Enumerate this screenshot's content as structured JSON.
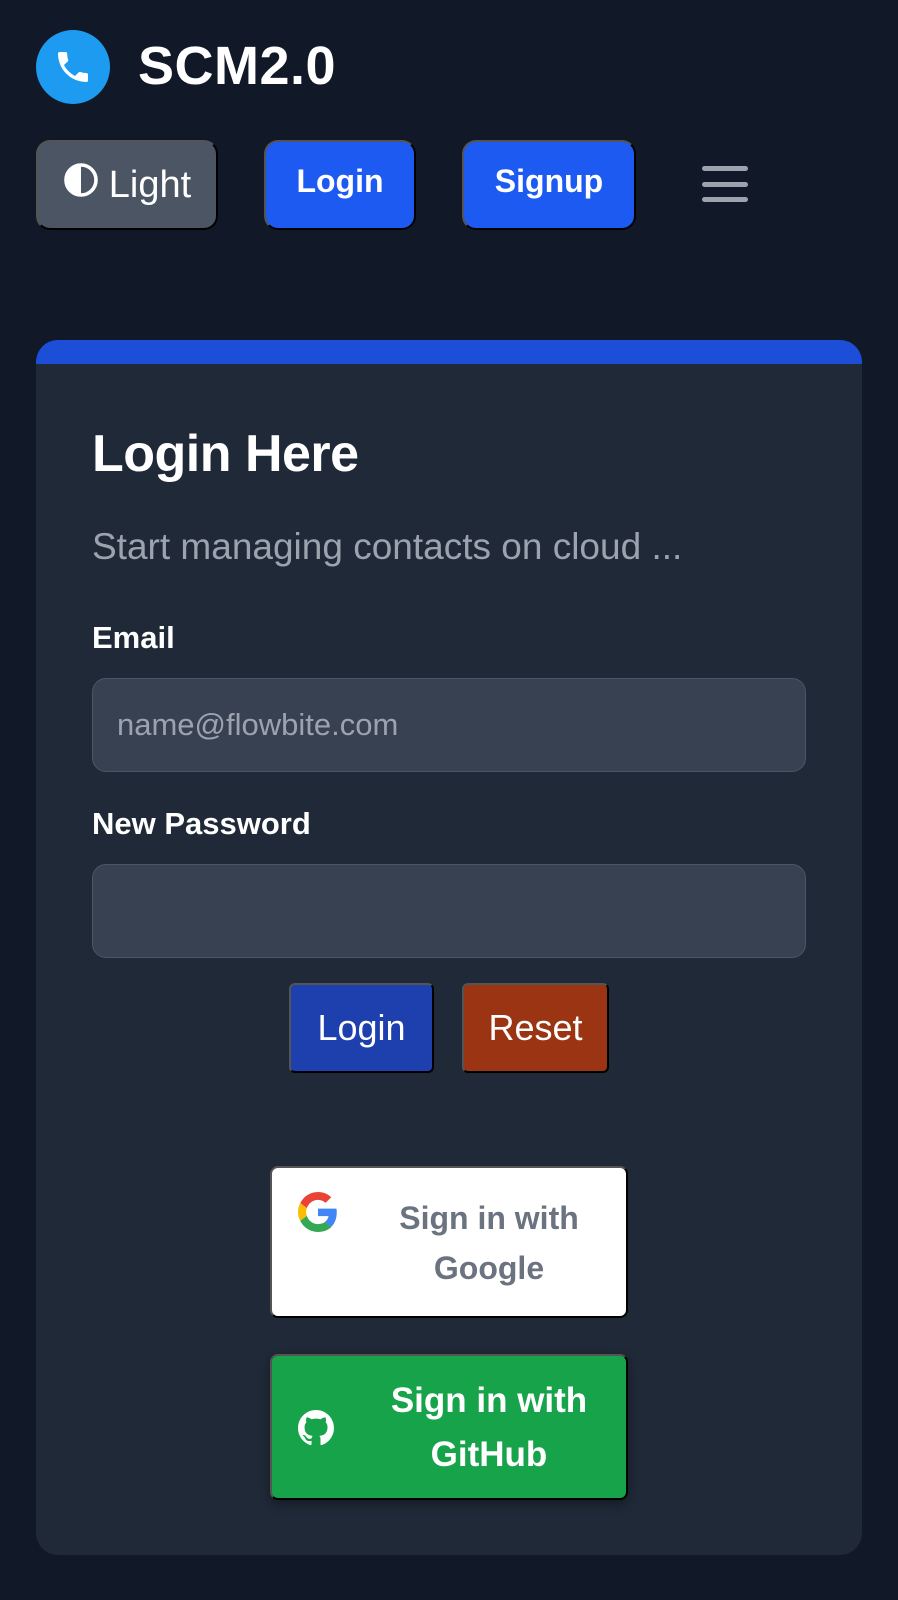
{
  "navbar": {
    "brand": "SCM2.0",
    "logo_icon": "phone-icon",
    "theme_toggle": {
      "icon": "contrast-icon",
      "label": "Light"
    },
    "login_label": "Login",
    "signup_label": "Signup",
    "menu_icon": "hamburger-menu-icon"
  },
  "login_card": {
    "accent_color": "#1d4ed8",
    "title": "Login Here",
    "subtitle": "Start managing contacts on cloud ...",
    "email": {
      "label": "Email",
      "placeholder": "name@flowbite.com",
      "value": ""
    },
    "password": {
      "label": "New Password",
      "placeholder": "",
      "value": ""
    },
    "login_button": "Login",
    "reset_button": "Reset",
    "google_button": {
      "icon": "google-icon",
      "label": "Sign in with Google"
    },
    "github_button": {
      "icon": "github-icon",
      "label": "Sign in with GitHub"
    }
  },
  "colors": {
    "background": "#111827",
    "card": "#1f2937",
    "primary": "#1d5af2",
    "reset": "#9a3412",
    "github": "#16a34a"
  }
}
